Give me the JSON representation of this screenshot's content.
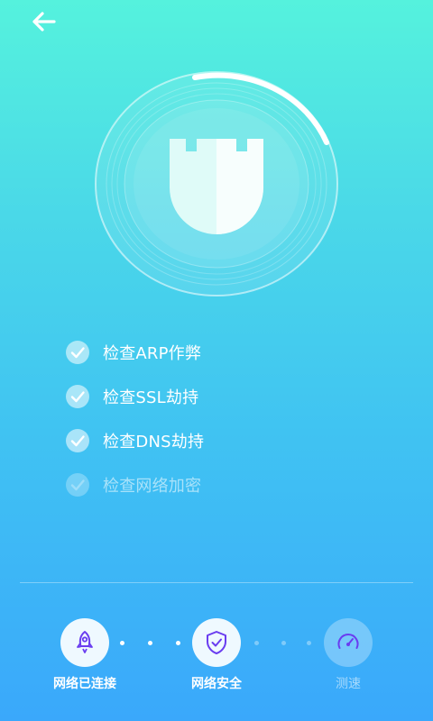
{
  "header": {
    "back_icon": "arrow-left-icon"
  },
  "scan": {
    "icon": "castle-shield-icon",
    "progress": 0.25
  },
  "checks": [
    {
      "label": "检查ARP作弊",
      "status": "done"
    },
    {
      "label": "检查SSL劫持",
      "status": "done"
    },
    {
      "label": "检查DNS劫持",
      "status": "done"
    },
    {
      "label": "检查网络加密",
      "status": "pending"
    }
  ],
  "steps": [
    {
      "label": "网络已连接",
      "icon": "rocket-icon",
      "state": "done"
    },
    {
      "label": "网络安全",
      "icon": "shield-check-icon",
      "state": "active"
    },
    {
      "label": "测速",
      "icon": "speedometer-icon",
      "state": "future"
    }
  ],
  "colors": {
    "gradient_top": "#55f2dd",
    "gradient_bottom": "#3aa8fb",
    "step_icon": "#6a3df0"
  }
}
